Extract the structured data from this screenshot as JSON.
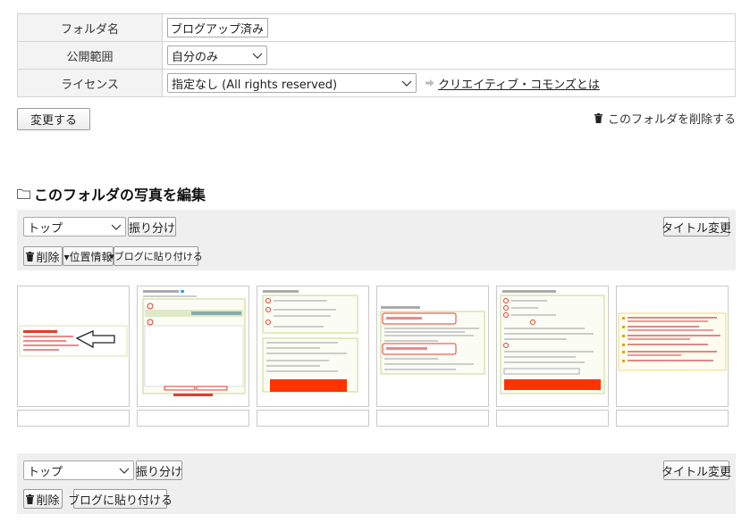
{
  "folder_settings": {
    "name_label": "フォルダ名",
    "name_value": "ブログアップ済み",
    "scope_label": "公開範囲",
    "scope_value": "自分のみ",
    "license_label": "ライセンス",
    "license_value": "指定なし (All rights reserved)",
    "cc_link": "クリエイティブ・コモンズとは"
  },
  "actions": {
    "change_button": "変更する",
    "delete_folder": "このフォルダを削除する"
  },
  "edit_section": {
    "title": "このフォルダの写真を編集"
  },
  "toolbar_top": {
    "target_value": "トップ",
    "sort_button": "振り分け",
    "rename_button": "タイトル変更",
    "delete_button": "削除",
    "location_button": "▾位置情報",
    "blog_button": "▾ブログに貼り付ける"
  },
  "toolbar_bottom": {
    "target_value": "トップ",
    "sort_button": "振り分け",
    "rename_button": "タイトル変更",
    "delete_button": "削除",
    "blog_button": "ブログに貼り付ける"
  },
  "photos": [
    {
      "name": "photo-1"
    },
    {
      "name": "photo-2"
    },
    {
      "name": "photo-3"
    },
    {
      "name": "photo-4"
    },
    {
      "name": "photo-5"
    },
    {
      "name": "photo-6"
    }
  ],
  "colors": {
    "accent_red": "#e53a2a",
    "thumb_border_green": "#c6d98a",
    "toolbar_bg": "#efefef"
  }
}
